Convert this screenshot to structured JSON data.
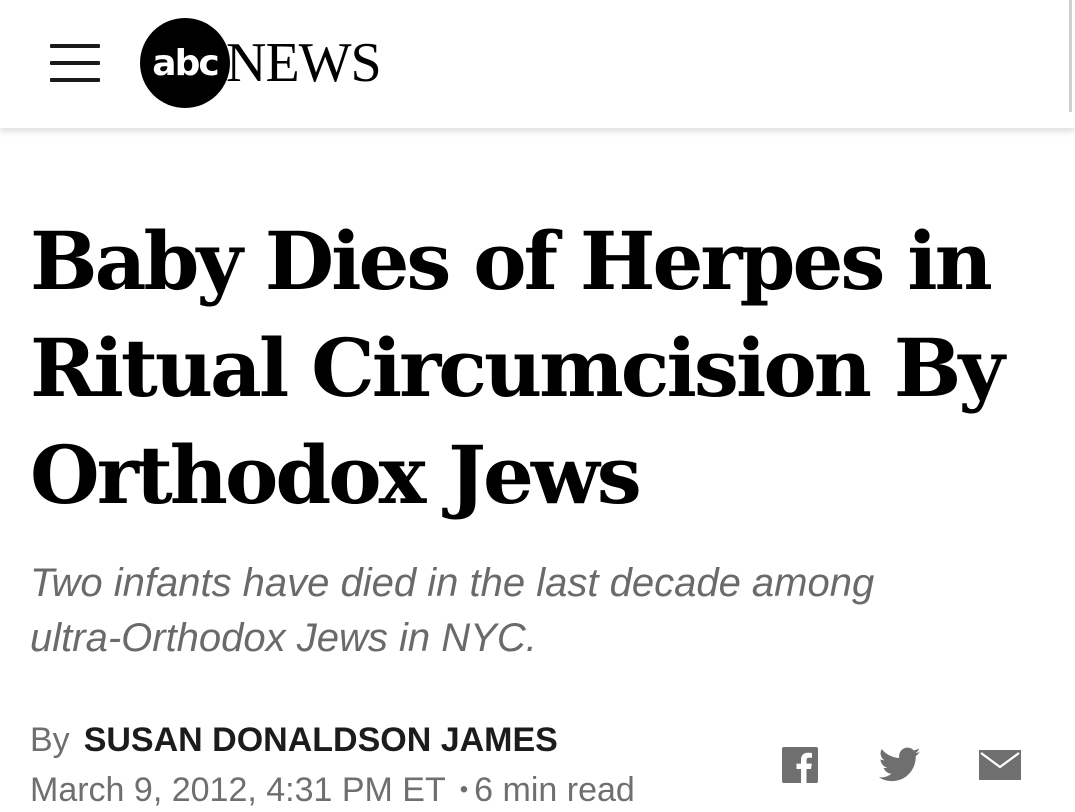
{
  "header": {
    "menu_icon": "hamburger-menu-icon",
    "logo_mark": "abc",
    "logo_word": "NEWS"
  },
  "article": {
    "headline_lines": [
      "Baby Dies of Herpes in",
      "Ritual Circumcision By",
      "Orthodox Jews"
    ],
    "subheadline_lines": [
      "Two infants have died in the last decade among",
      "ultra-Orthodox Jews in NYC."
    ],
    "byline_prefix": "By",
    "author": "SUSAN DONALDSON JAMES",
    "date": "March 9, 2012, 4:31 PM ET",
    "separator": "•",
    "read_time": "6 min read"
  },
  "share": {
    "facebook_icon": "facebook-icon",
    "twitter_icon": "twitter-icon",
    "email_icon": "email-icon"
  },
  "colors": {
    "text_primary": "#000000",
    "text_secondary": "#6f6f6f",
    "background": "#ffffff"
  }
}
